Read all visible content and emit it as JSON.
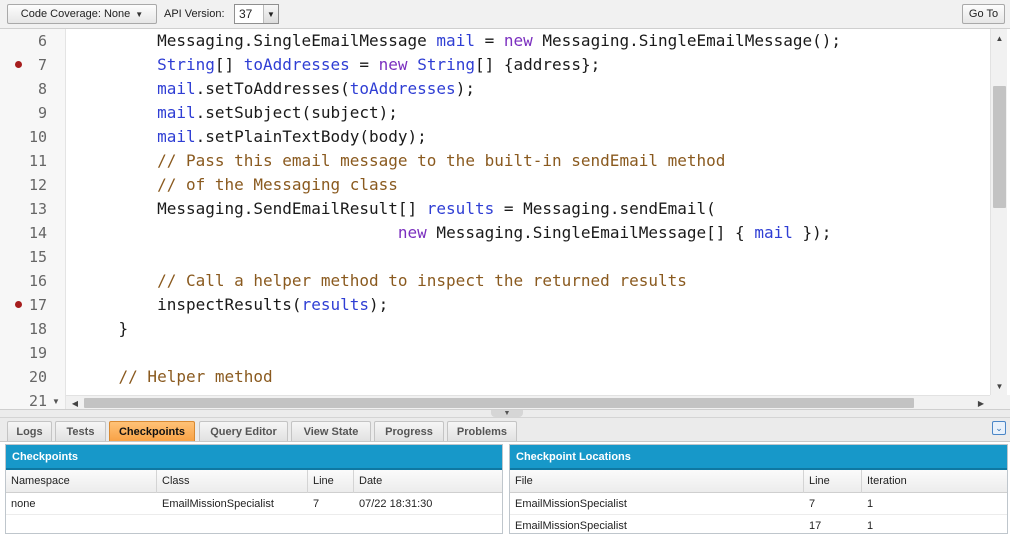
{
  "toolbar": {
    "coverage_label": "Code Coverage: None",
    "api_label": "API Version:",
    "api_value": "37",
    "goto_label": "Go To"
  },
  "editor": {
    "lines": [
      {
        "num": "6",
        "breakpoint": false,
        "fold": false,
        "code": "        Messaging.SingleEmailMessage mail = new Messaging.SingleEmailMessage();"
      },
      {
        "num": "7",
        "breakpoint": true,
        "fold": false,
        "code": "        String[] toAddresses = new String[] {address};"
      },
      {
        "num": "8",
        "breakpoint": false,
        "fold": false,
        "code": "        mail.setToAddresses(toAddresses);"
      },
      {
        "num": "9",
        "breakpoint": false,
        "fold": false,
        "code": "        mail.setSubject(subject);"
      },
      {
        "num": "10",
        "breakpoint": false,
        "fold": false,
        "code": "        mail.setPlainTextBody(body);"
      },
      {
        "num": "11",
        "breakpoint": false,
        "fold": false,
        "code": "        // Pass this email message to the built-in sendEmail method"
      },
      {
        "num": "12",
        "breakpoint": false,
        "fold": false,
        "code": "        // of the Messaging class"
      },
      {
        "num": "13",
        "breakpoint": false,
        "fold": false,
        "code": "        Messaging.SendEmailResult[] results = Messaging.sendEmail("
      },
      {
        "num": "14",
        "breakpoint": false,
        "fold": false,
        "code": "                                 new Messaging.SingleEmailMessage[] { mail });"
      },
      {
        "num": "15",
        "breakpoint": false,
        "fold": false,
        "code": ""
      },
      {
        "num": "16",
        "breakpoint": false,
        "fold": false,
        "code": "        // Call a helper method to inspect the returned results"
      },
      {
        "num": "17",
        "breakpoint": true,
        "fold": false,
        "code": "        inspectResults(results);"
      },
      {
        "num": "18",
        "breakpoint": false,
        "fold": false,
        "code": "    }"
      },
      {
        "num": "19",
        "breakpoint": false,
        "fold": false,
        "code": ""
      },
      {
        "num": "20",
        "breakpoint": false,
        "fold": false,
        "code": "    // Helper method"
      },
      {
        "num": "21",
        "breakpoint": false,
        "fold": true,
        "code": ""
      }
    ]
  },
  "tabs": [
    {
      "label": "Logs",
      "active": false
    },
    {
      "label": "Tests",
      "active": false
    },
    {
      "label": "Checkpoints",
      "active": true
    },
    {
      "label": "Query Editor",
      "active": false
    },
    {
      "label": "View State",
      "active": false
    },
    {
      "label": "Progress",
      "active": false
    },
    {
      "label": "Problems",
      "active": false
    }
  ],
  "checkpoints": {
    "title": "Checkpoints",
    "columns": [
      "Namespace",
      "Class",
      "Line",
      "Date"
    ],
    "rows": [
      {
        "namespace": "none",
        "class": "EmailMissionSpecialist",
        "line": "7",
        "date": "07/22 18:31:30"
      }
    ]
  },
  "locations": {
    "title": "Checkpoint Locations",
    "columns": [
      "File",
      "Line",
      "Iteration"
    ],
    "rows": [
      {
        "file": "EmailMissionSpecialist",
        "line": "7",
        "iteration": "1"
      },
      {
        "file": "EmailMissionSpecialist",
        "line": "17",
        "iteration": "1"
      }
    ]
  },
  "colors": {
    "panel_header": "#1798c9",
    "active_tab": "#f8a246",
    "breakpoint": "#a61d1d",
    "keyword": "#7b2fbf",
    "type": "#2f3ed4",
    "comment": "#8a5a1f"
  }
}
